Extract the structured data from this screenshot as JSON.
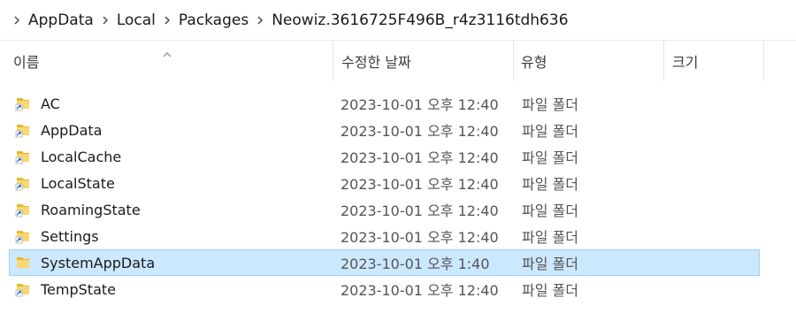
{
  "breadcrumb": {
    "items": [
      "AppData",
      "Local",
      "Packages",
      "Neowiz.3616725F496B_r4z3116tdh636"
    ]
  },
  "columns": {
    "name": "이름",
    "date": "수정한 날짜",
    "type": "유형",
    "size": "크기"
  },
  "files": [
    {
      "name": "AC",
      "date": "2023-10-01 오후 12:40",
      "type": "파일 폴더",
      "shortcut": true
    },
    {
      "name": "AppData",
      "date": "2023-10-01 오후 12:40",
      "type": "파일 폴더",
      "shortcut": true
    },
    {
      "name": "LocalCache",
      "date": "2023-10-01 오후 12:40",
      "type": "파일 폴더",
      "shortcut": true
    },
    {
      "name": "LocalState",
      "date": "2023-10-01 오후 12:40",
      "type": "파일 폴더",
      "shortcut": true
    },
    {
      "name": "RoamingState",
      "date": "2023-10-01 오후 12:40",
      "type": "파일 폴더",
      "shortcut": true
    },
    {
      "name": "Settings",
      "date": "2023-10-01 오후 12:40",
      "type": "파일 폴더",
      "shortcut": true
    },
    {
      "name": "SystemAppData",
      "date": "2023-10-01 오후 1:40",
      "type": "파일 폴더",
      "shortcut": false,
      "selected": true
    },
    {
      "name": "TempState",
      "date": "2023-10-01 오후 12:40",
      "type": "파일 폴더",
      "shortcut": true
    }
  ],
  "colors": {
    "selection_bg": "#cce8ff",
    "selection_border": "#99d1ff",
    "folder_yellow": "#f8d775"
  },
  "icons": {
    "folder": "folder-icon",
    "shortcut": "shortcut-arrow-icon",
    "separator": "chevron-right-icon",
    "sort": "sort-ascending-icon"
  }
}
